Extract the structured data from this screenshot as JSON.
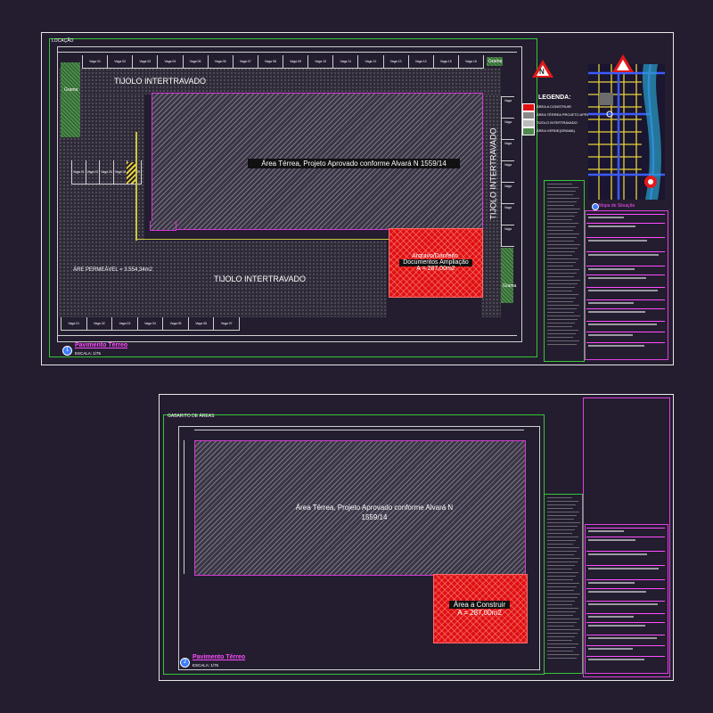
{
  "sheet1": {
    "corner_label": "LOCAÇÃO",
    "paver_top": "TIJOLO INTERTRAVADO",
    "paver_bottom": "TIJOLO INTERTRAVADO",
    "paver_right": "TIJOLO INTERTRAVADO",
    "building_label": "Área Térrea, Projeto Aprovado conforme Alvará N 1559/14",
    "red_area_line1": "Arquivo/Danfeito",
    "red_area_line2": "Documentos Ampliação",
    "red_area_line3": "A = 287,00m2",
    "permeable_label": "ÁRE PERMEÁVEL = 3.554,34m2",
    "grass_label": "Grama",
    "caption_number": "1",
    "caption": "Pavimento Térreo",
    "scale": "ESCALA: 1/75",
    "legend_title": "LEGENDA:",
    "legend": [
      {
        "label": "ÁREA A CONSTRUIR",
        "color": "#e01010"
      },
      {
        "label": "ÁREA TÉRREA PROJETO APROVADO",
        "color": "#888888"
      },
      {
        "label": "TIJOLO INTERTRAVADO",
        "color": "#bbbbbb"
      },
      {
        "label": "ÁREA VERDE(GRAMA)",
        "color": "#4e8a4e"
      }
    ],
    "location_caption": "Mapa de Situação",
    "stalls_top": [
      "Vaga 01",
      "Vaga 02",
      "Vaga 03",
      "Vaga 04",
      "Vaga 05",
      "Vaga 06",
      "Vaga 07",
      "Vaga 08",
      "Vaga 09",
      "Vaga 10",
      "Vaga 11",
      "Vaga 12",
      "Vaga 13",
      "Vaga 14",
      "Vaga 15",
      "Vaga 16"
    ],
    "stalls_left": [
      "Vaga 01",
      "Vaga 02",
      "Vaga 03",
      "Vaga 04",
      "Vaga 05"
    ],
    "stalls_bottom": [
      "Vaga 01",
      "Vaga 02",
      "Vaga 03",
      "Vaga 04",
      "Vaga 05",
      "Vaga 06",
      "Vaga 07"
    ],
    "stalls_right": [
      "Vaga",
      "Vaga",
      "Vaga",
      "Vaga",
      "Vaga",
      "Vaga",
      "Vaga"
    ]
  },
  "sheet2": {
    "corner_label": "GABARITO DE ÁREAS",
    "building_label": "Área Térrea, Projeto Aprovado conforme Alvará N 1559/14",
    "red_area_line1": "Área a Construir",
    "red_area_line2": "A = 287,00m2",
    "caption_number": "2",
    "caption": "Pavimento Térreo",
    "scale": "ESCALA: 1/75"
  },
  "north_letter": "N",
  "colors": {
    "background": "#231d2f",
    "frame": "#e8e8e8",
    "magenta": "#e040e0",
    "green_frame": "#36c636",
    "red_area": "#e01010",
    "grass": "#4e8a4e"
  }
}
